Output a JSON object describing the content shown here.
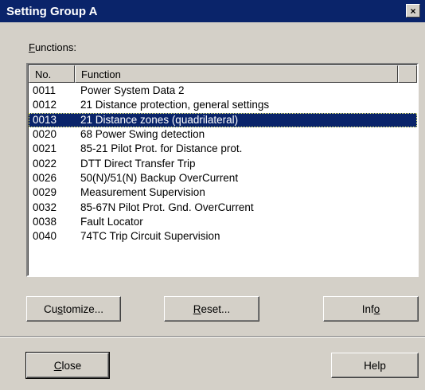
{
  "window": {
    "title": "Setting Group A",
    "close_glyph": "×"
  },
  "functions_label": {
    "mnemonic": "F",
    "rest": "unctions:"
  },
  "list": {
    "headers": {
      "no": "No.",
      "function": "Function"
    },
    "rows": [
      {
        "no": "0011",
        "function": "Power System Data 2"
      },
      {
        "no": "0012",
        "function": "21 Distance protection, general settings"
      },
      {
        "no": "0013",
        "function": "21 Distance zones (quadrilateral)"
      },
      {
        "no": "0020",
        "function": "68 Power Swing detection"
      },
      {
        "no": "0021",
        "function": "85-21 Pilot Prot. for Distance prot."
      },
      {
        "no": "0022",
        "function": "DTT Direct Transfer Trip"
      },
      {
        "no": "0026",
        "function": "50(N)/51(N) Backup OverCurrent"
      },
      {
        "no": "0029",
        "function": "Measurement Supervision"
      },
      {
        "no": "0032",
        "function": "85-67N Pilot Prot. Gnd. OverCurrent"
      },
      {
        "no": "0038",
        "function": "Fault Locator"
      },
      {
        "no": "0040",
        "function": "74TC Trip Circuit Supervision"
      }
    ],
    "selected_no": "0013"
  },
  "buttons": {
    "customize": {
      "pre": "Cu",
      "mnemonic": "s",
      "post": "tomize..."
    },
    "reset": {
      "pre": "",
      "mnemonic": "R",
      "post": "eset..."
    },
    "info": {
      "pre": "Inf",
      "mnemonic": "o",
      "post": ""
    },
    "close": {
      "pre": "",
      "mnemonic": "C",
      "post": "lose"
    },
    "help": {
      "label": "Help"
    }
  },
  "colors": {
    "dialog_bg": "#d4d0c8",
    "titlebar_bg": "#0a246a",
    "selection_bg": "#0a246a",
    "list_bg": "#ffffff"
  }
}
